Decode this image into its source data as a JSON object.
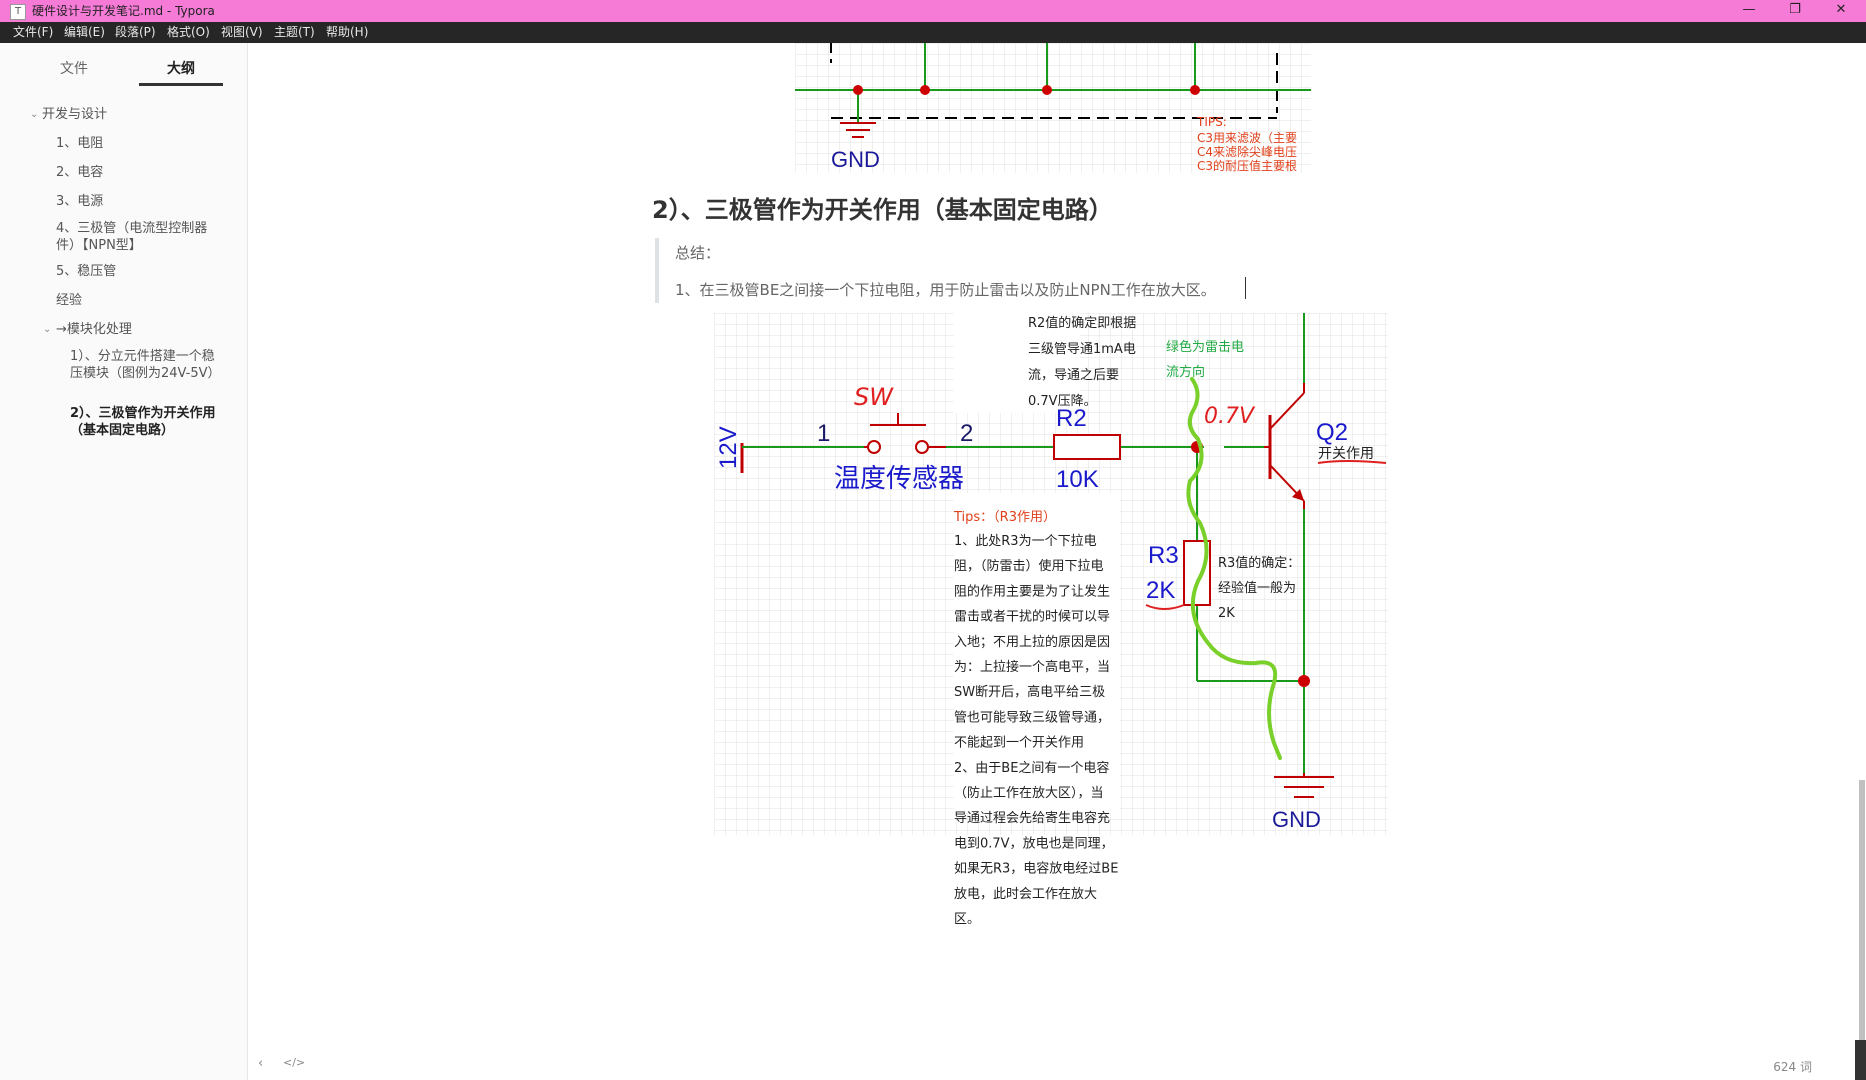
{
  "window": {
    "title": "硬件设计与开发笔记.md - Typora",
    "app_icon": "T",
    "controls": [
      "—",
      "❐",
      "✕"
    ]
  },
  "menu": [
    "文件(F)",
    "编辑(E)",
    "段落(P)",
    "格式(O)",
    "视图(V)",
    "主题(T)",
    "帮助(H)"
  ],
  "sidebar": {
    "tabs": [
      "文件",
      "大纲"
    ],
    "active_tab": "大纲",
    "outline": [
      {
        "label": "开发与设计"
      },
      {
        "label": "1、电阻"
      },
      {
        "label": "2、电容"
      },
      {
        "label": "3、电源"
      },
      {
        "label": "4、三极管（电流型控制器件）【NPN型】"
      },
      {
        "label": "5、稳压管"
      },
      {
        "label": "经验"
      },
      {
        "label": "→模块化处理"
      },
      {
        "label": "1）、分立元件搭建一个稳压模块（图例为24V-5V）"
      },
      {
        "label": "2）、三极管作为开关作用（基本固定电路）"
      }
    ]
  },
  "top_fig": {
    "gnd": "GND",
    "tips_title": "TIPS:",
    "tips": [
      "C3用来滤波（主要",
      "C4来滤除尖峰电压",
      "C3的耐压值主要根"
    ]
  },
  "heading": "2）、三极管作为开关作用（基本固定电路）",
  "quote": {
    "line1": "总结：",
    "line2": "1、在三极管BE之间接一个下拉电阻，用于防止雷击以及防止NPN工作在放大区。"
  },
  "circuit": {
    "v12": "12V",
    "pin1": "1",
    "pin2": "2",
    "sw": "SW",
    "sensor": "温度传感器",
    "r2": "R2",
    "r2val": "10K",
    "r3": "R3",
    "r3val": "2K",
    "q2": "Q2",
    "q2note": "开关作用",
    "v07": "0.7V",
    "gnd": "GND",
    "r2note": [
      "R2值的确定即根据",
      "三级管导通1mA电",
      "流，导通之后要",
      "0.7V压降。"
    ],
    "green_note": [
      "绿色为雷击电",
      "流方向"
    ],
    "r3note": [
      "R3值的确定：",
      "经验值一般为",
      "2K"
    ],
    "tips_title": "Tips：（R3作用）",
    "tips_lines": [
      "1、此处R3为一个下拉电",
      "阻，（防雷击）使用下拉电",
      "阻的作用主要是为了让发生",
      "雷击或者干扰的时候可以导",
      "入地；不用上拉的原因是因",
      "为：上拉接一个高电平，当",
      "SW断开后，高电平给三极",
      "管也可能导致三级管导通，",
      "不能起到一个开关作用",
      "2、由于BE之间有一个电容",
      "（防止工作在放大区），当",
      "导通过程会先给寄生电容充",
      "电到0.7V，放电也是同理，",
      "如果无R3，电容放电经过BE",
      "放电，此时会工作在放大",
      "区。"
    ]
  },
  "status": {
    "word_count": "624 词",
    "left_icons": [
      "chevron-left-icon",
      "code-icon"
    ]
  },
  "colors": {
    "titlebar": "#f57bd6",
    "menubar": "#262626",
    "wire": "#1a9a1a",
    "component": "#c00000",
    "label_blue": "#1a1acc",
    "tips_red": "#e0401a"
  }
}
